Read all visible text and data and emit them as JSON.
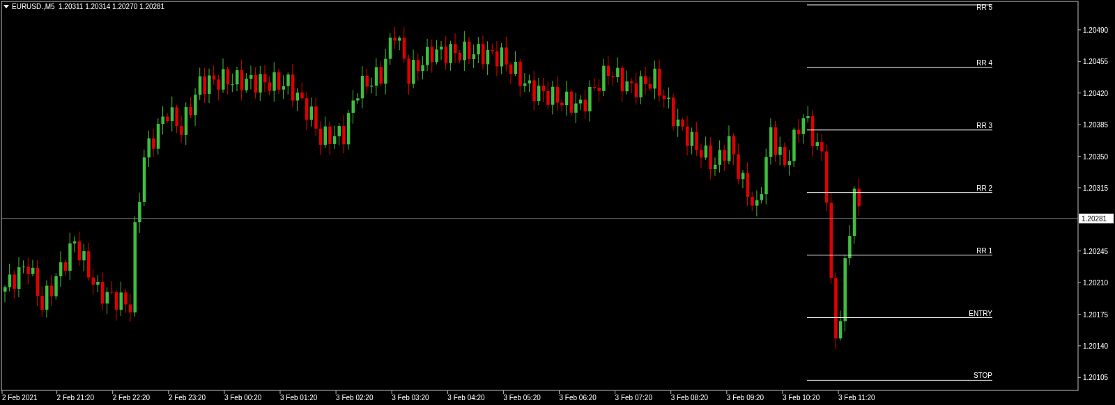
{
  "header": {
    "symbol": "EURUSD.,M5",
    "prices": [
      "1.20311",
      "1.20314",
      "1.20270",
      "1.20281"
    ]
  },
  "price_axis": {
    "ticks": [
      "1.20490",
      "1.20455",
      "1.20420",
      "1.20385",
      "1.20350",
      "1.20315",
      "1.20245",
      "1.20210",
      "1.20175",
      "1.20140",
      "1.20105"
    ],
    "current_price": "1.20281"
  },
  "time_axis": {
    "ticks": [
      "2 Feb 2021",
      "2 Feb 21:20",
      "2 Feb 22:20",
      "2 Feb 23:20",
      "3 Feb 00:20",
      "3 Feb 01:20",
      "3 Feb 02:20",
      "3 Feb 03:20",
      "3 Feb 04:20",
      "3 Feb 05:20",
      "3 Feb 06:20",
      "3 Feb 07:20",
      "3 Feb 08:20",
      "3 Feb 09:20",
      "3 Feb 10:20",
      "3 Feb 11:20"
    ]
  },
  "levels": [
    {
      "label": "RR 5"
    },
    {
      "label": "RR 4"
    },
    {
      "label": "RR 3"
    },
    {
      "label": "RR 2"
    },
    {
      "label": "RR 1"
    },
    {
      "label": "ENTRY"
    },
    {
      "label": "STOP"
    }
  ]
}
